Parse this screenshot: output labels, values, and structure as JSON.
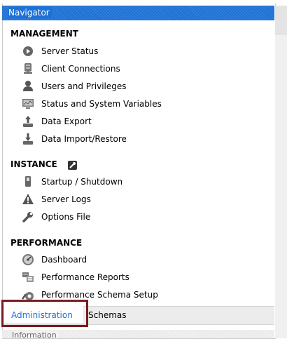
{
  "navigator": {
    "title": "Navigator"
  },
  "management": {
    "title": "MANAGEMENT",
    "items": [
      {
        "label": "Server Status",
        "icon": "server-status-icon"
      },
      {
        "label": "Client Connections",
        "icon": "client-connections-icon"
      },
      {
        "label": "Users and Privileges",
        "icon": "user-icon"
      },
      {
        "label": "Status and System Variables",
        "icon": "monitor-icon"
      },
      {
        "label": "Data Export",
        "icon": "data-export-icon"
      },
      {
        "label": "Data Import/Restore",
        "icon": "data-import-icon"
      }
    ]
  },
  "instance": {
    "title": "INSTANCE",
    "items": [
      {
        "label": "Startup / Shutdown",
        "icon": "power-switch-icon"
      },
      {
        "label": "Server Logs",
        "icon": "warning-icon"
      },
      {
        "label": "Options File",
        "icon": "wrench-icon"
      }
    ]
  },
  "performance": {
    "title": "PERFORMANCE",
    "items": [
      {
        "label": "Dashboard",
        "icon": "dashboard-icon"
      },
      {
        "label": "Performance Reports",
        "icon": "reports-icon"
      },
      {
        "label": "Performance Schema Setup",
        "icon": "schema-setup-icon"
      }
    ]
  },
  "tabs": [
    {
      "label": "Administration",
      "active": true
    },
    {
      "label": "Schemas",
      "active": false
    }
  ],
  "info": {
    "title": "Information"
  },
  "colors": {
    "accent": "#1e71d4",
    "highlight_border": "#7a1c1f"
  }
}
